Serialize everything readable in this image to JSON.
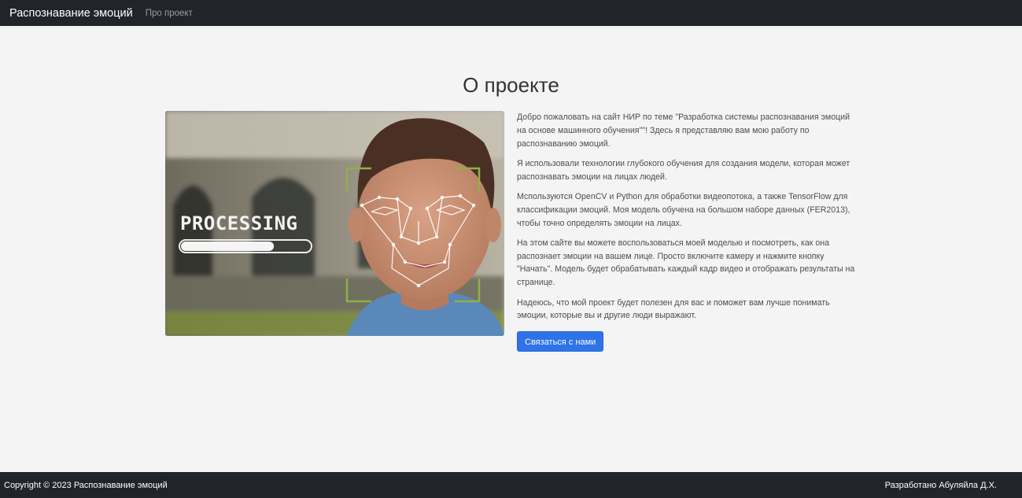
{
  "navbar": {
    "brand": "Распознавание эмоций",
    "links": [
      "Про проект"
    ]
  },
  "page": {
    "title": "О проекте",
    "image_caption": "PROCESSING",
    "processing_progress": 0.72,
    "paragraphs": [
      "Добро пожаловать на сайт НИР по теме \"Разработка системы распознавания эмоций на основе машинного обучения\"\"! Здесь я представляю вам мою работу по распознаванию эмоций.",
      "Я использовали технологии глубокого обучения для создания модели, которая может распознавать эмоции на лицах людей.",
      "Мспользуются OpenCV и Python для обработки видеопотока, а также TensorFlow для классификации эмоций. Моя модель обучена на большом наборе данных (FER2013), чтобы точно определять эмоции на лицах.",
      "На этом сайте вы можете воспользоваться моей моделью и посмотреть, как она распознает эмоции на вашем лице. Просто включите камеру и нажмите кнопку \"Начать\". Модель будет обрабатывать каждый кадр видео и отображать результаты на странице.",
      "Надеюсь, что мой проект будет полезен для вас и поможет вам лучше понимать эмоции, которые вы и другие люди выражают."
    ],
    "contact_button": "Связаться с нами"
  },
  "footer": {
    "copyright": "Copyright © 2023 Распознавание эмоций",
    "author": "Разработано Абуляйла Д.Х."
  },
  "colors": {
    "navbar_bg": "#212529",
    "page_bg": "#f4f4f4",
    "accent": "#2e73e8",
    "frame_green": "#8fb04a"
  }
}
